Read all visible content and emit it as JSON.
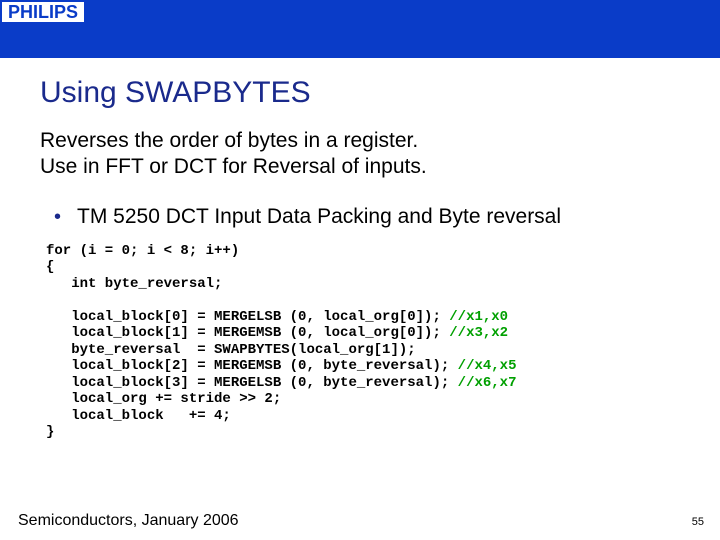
{
  "logo": "PHILIPS",
  "title": "Using SWAPBYTES",
  "subtitle_line1": "Reverses the order of bytes in a register.",
  "subtitle_line2": "Use in FFT or DCT for Reversal of inputs.",
  "bullet1": "TM 5250 DCT Input Data Packing and Byte reversal",
  "code": {
    "l1": "for (i = 0; i < 8; i++)",
    "l2": "{",
    "l3": "   int byte_reversal;",
    "l4": "",
    "l5a": "   local_block[0] = MERGELSB (0, local_org[0]); ",
    "l5b": "//x1,x0",
    "l6a": "   local_block[1] = MERGEMSB (0, local_org[0]); ",
    "l6b": "//x3,x2",
    "l7": "   byte_reversal  = SWAPBYTES(local_org[1]);",
    "l8a": "   local_block[2] = MERGEMSB (0, byte_reversal); ",
    "l8b": "//x4,x5",
    "l9a": "   local_block[3] = MERGELSB (0, byte_reversal); ",
    "l9b": "//x6,x7",
    "l10": "   local_org += stride >> 2;",
    "l11": "   local_block   += 4;",
    "l12": "}"
  },
  "footer": "Semiconductors, January 2006",
  "page_number": "55"
}
